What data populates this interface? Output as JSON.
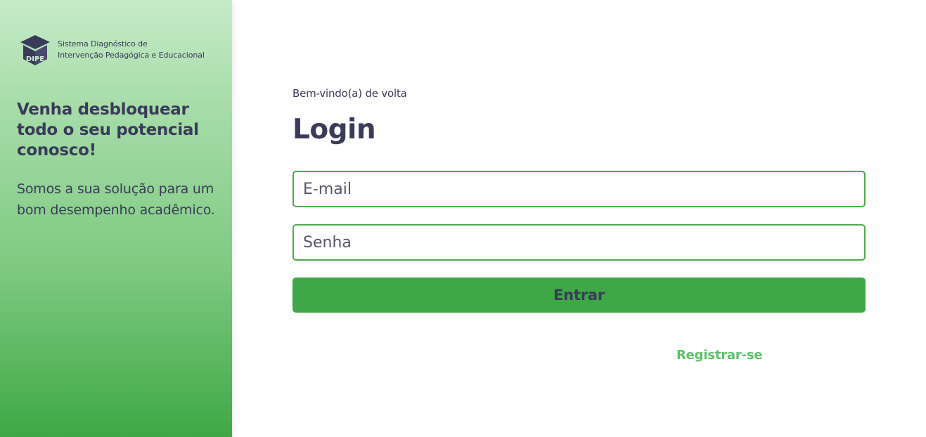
{
  "sidebar": {
    "brand": {
      "line1": "Sistema Diagnóstico de",
      "line2": "Intervenção Pedagógica e Educacional",
      "logo_text": "DIPE"
    },
    "headline": {
      "part1": "Venha desbloquear todo o seu ",
      "highlight": "potencial",
      "part2": " conosco!"
    },
    "subtext": "Somos a sua solução para um bom desempenho acadêmico."
  },
  "login": {
    "welcome": "Bem-vindo(a) de volta",
    "title": "Login",
    "email": {
      "placeholder": "E-mail",
      "value": ""
    },
    "password": {
      "placeholder": "Senha",
      "value": ""
    },
    "submit_label": "Entrar",
    "register_label": "Registrar-se"
  },
  "colors": {
    "primary": "#3ea846",
    "input_border": "#4caa4f",
    "link": "#5cc266",
    "text": "#3a3a5a"
  }
}
